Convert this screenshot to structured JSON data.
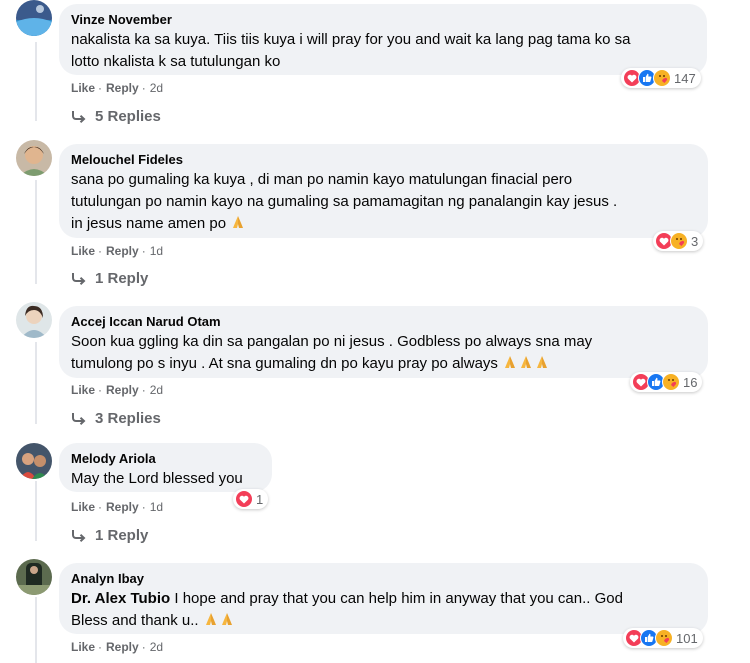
{
  "comments": [
    {
      "author": "Vinze November",
      "text_lines": [
        "nakalista ka sa kuya. Tiis tiis kuya i will pray for you and wait ka lang pag tama ko sa",
        "lotto nkalista k sa tutulungan ko"
      ],
      "reaction_icons": [
        "love",
        "like",
        "care"
      ],
      "reaction_count": "147",
      "like_label": "Like",
      "reply_label": "Reply",
      "time": "2d",
      "replies_label": "5 Replies"
    },
    {
      "author": "Melouchel Fideles",
      "text_lines": [
        "sana po gumaling ka kuya , di man po namin kayo matulungan finacial pero",
        "tutulungan po namin kayo na gumaling sa pamamagitan ng panalangin kay jesus .",
        "in jesus name amen po"
      ],
      "reaction_icons": [
        "love",
        "care"
      ],
      "reaction_count": "3",
      "like_label": "Like",
      "reply_label": "Reply",
      "time": "1d",
      "replies_label": "1 Reply"
    },
    {
      "author": "Accej Iccan Narud Otam",
      "text_lines": [
        "Soon kua ggling ka din sa pangalan po ni jesus . Godbless po always sna may",
        "tumulong po s inyu . At sna gumaling dn po kayu pray po always"
      ],
      "reaction_icons": [
        "love",
        "like",
        "care"
      ],
      "reaction_count": "16",
      "like_label": "Like",
      "reply_label": "Reply",
      "time": "2d",
      "replies_label": "3 Replies"
    },
    {
      "author": "Melody Ariola",
      "text_lines": [
        "May the Lord blessed you"
      ],
      "reaction_icons": [
        "love"
      ],
      "reaction_count": "1",
      "like_label": "Like",
      "reply_label": "Reply",
      "time": "1d",
      "replies_label": "1 Reply"
    },
    {
      "author": "Analyn Ibay",
      "mention": "Dr. Alex Tubio",
      "text_lines": [
        "I hope and pray that you can help him in anyway that you can.. God",
        "Bless and thank u.."
      ],
      "reaction_icons": [
        "love",
        "like",
        "care"
      ],
      "reaction_count": "101",
      "like_label": "Like",
      "reply_label": "Reply",
      "time": "2d"
    }
  ],
  "colors": {
    "bubble": "#f0f2f5",
    "secondary_text": "#65676b",
    "like_blue": "#1877f2",
    "love_red": "#f33e58",
    "care_yellow": "#f7b125"
  }
}
